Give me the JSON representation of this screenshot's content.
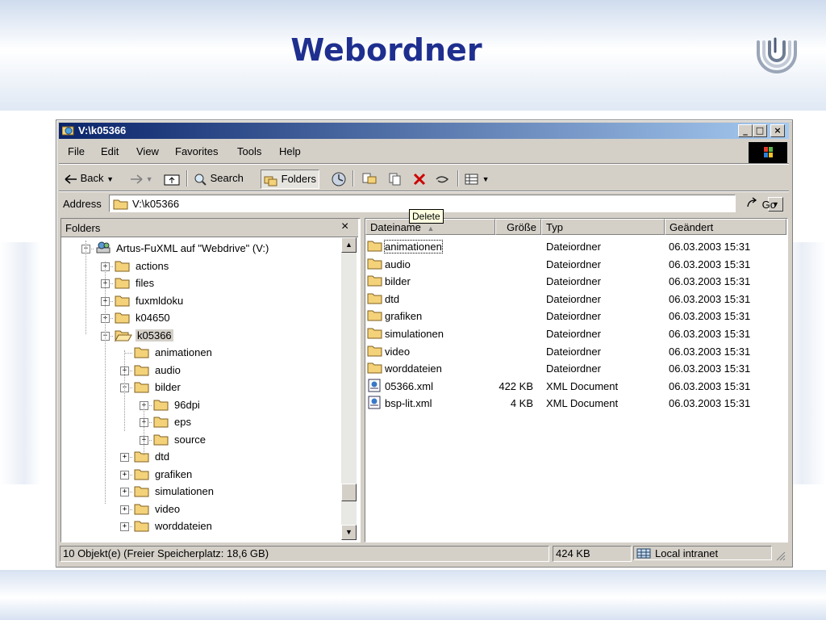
{
  "slide": {
    "title": "Webordner",
    "colors": {
      "title": "#1e2f8f",
      "titlebar_start": "#0a246a",
      "titlebar_end": "#a6caf0",
      "delete_icon": "#cc0000"
    }
  },
  "window": {
    "title": "V:\\k05366",
    "controls": {
      "minimize": "_",
      "maximize": "□",
      "close": "×"
    }
  },
  "menu": [
    "File",
    "Edit",
    "View",
    "Favorites",
    "Tools",
    "Help"
  ],
  "toolbar": {
    "back": "Back",
    "search": "Search",
    "folders": "Folders",
    "icons": [
      "back-arrow-icon",
      "forward-arrow-icon",
      "up-folder-icon",
      "search-icon",
      "folders-icon",
      "history-icon",
      "move-to-icon",
      "copy-to-icon",
      "delete-icon",
      "undo-icon",
      "views-icon"
    ]
  },
  "address": {
    "label": "Address",
    "value": "V:\\k05366",
    "go": "Go"
  },
  "folders_pane": {
    "header": "Folders",
    "close": "×",
    "tree": [
      {
        "label": "Artus-FuXML auf \"Webdrive\" (V:)",
        "toggle": "−"
      },
      {
        "label": "actions",
        "toggle": "+"
      },
      {
        "label": "files",
        "toggle": "+"
      },
      {
        "label": "fuxmldoku",
        "toggle": "+"
      },
      {
        "label": "k04650",
        "toggle": "+"
      },
      {
        "label": "k05366",
        "toggle": "−"
      },
      {
        "label": "animationen",
        "toggle": ""
      },
      {
        "label": "audio",
        "toggle": "+"
      },
      {
        "label": "bilder",
        "toggle": "−"
      },
      {
        "label": "96dpi",
        "toggle": "+"
      },
      {
        "label": "eps",
        "toggle": "+"
      },
      {
        "label": "source",
        "toggle": "+"
      },
      {
        "label": "dtd",
        "toggle": "+"
      },
      {
        "label": "grafiken",
        "toggle": "+"
      },
      {
        "label": "simulationen",
        "toggle": "+"
      },
      {
        "label": "video",
        "toggle": "+"
      },
      {
        "label": "worddateien",
        "toggle": "+"
      }
    ]
  },
  "file_list": {
    "columns": [
      "Dateiname",
      "Größe",
      "Typ",
      "Geändert"
    ],
    "sort_indicator": "▲",
    "tooltip": "Delete",
    "rows": [
      {
        "name": "animationen",
        "size": "",
        "type": "Dateiordner",
        "modified": "06.03.2003 15:31",
        "icon": "folder-icon"
      },
      {
        "name": "audio",
        "size": "",
        "type": "Dateiordner",
        "modified": "06.03.2003 15:31",
        "icon": "folder-icon"
      },
      {
        "name": "bilder",
        "size": "",
        "type": "Dateiordner",
        "modified": "06.03.2003 15:31",
        "icon": "folder-icon"
      },
      {
        "name": "dtd",
        "size": "",
        "type": "Dateiordner",
        "modified": "06.03.2003 15:31",
        "icon": "folder-icon"
      },
      {
        "name": "grafiken",
        "size": "",
        "type": "Dateiordner",
        "modified": "06.03.2003 15:31",
        "icon": "folder-icon"
      },
      {
        "name": "simulationen",
        "size": "",
        "type": "Dateiordner",
        "modified": "06.03.2003 15:31",
        "icon": "folder-icon"
      },
      {
        "name": "video",
        "size": "",
        "type": "Dateiordner",
        "modified": "06.03.2003 15:31",
        "icon": "folder-icon"
      },
      {
        "name": "worddateien",
        "size": "",
        "type": "Dateiordner",
        "modified": "06.03.2003 15:31",
        "icon": "folder-icon"
      },
      {
        "name": "05366.xml",
        "size": "422 KB",
        "type": "XML Document",
        "modified": "06.03.2003 15:31",
        "icon": "xml-file-icon"
      },
      {
        "name": "bsp-lit.xml",
        "size": "4 KB",
        "type": "XML Document",
        "modified": "06.03.2003 15:31",
        "icon": "xml-file-icon"
      }
    ]
  },
  "status": {
    "objects": "10 Objekt(e)  (Freier Speicherplatz: 18,6 GB)",
    "size": "424 KB",
    "zone": "Local intranet"
  }
}
